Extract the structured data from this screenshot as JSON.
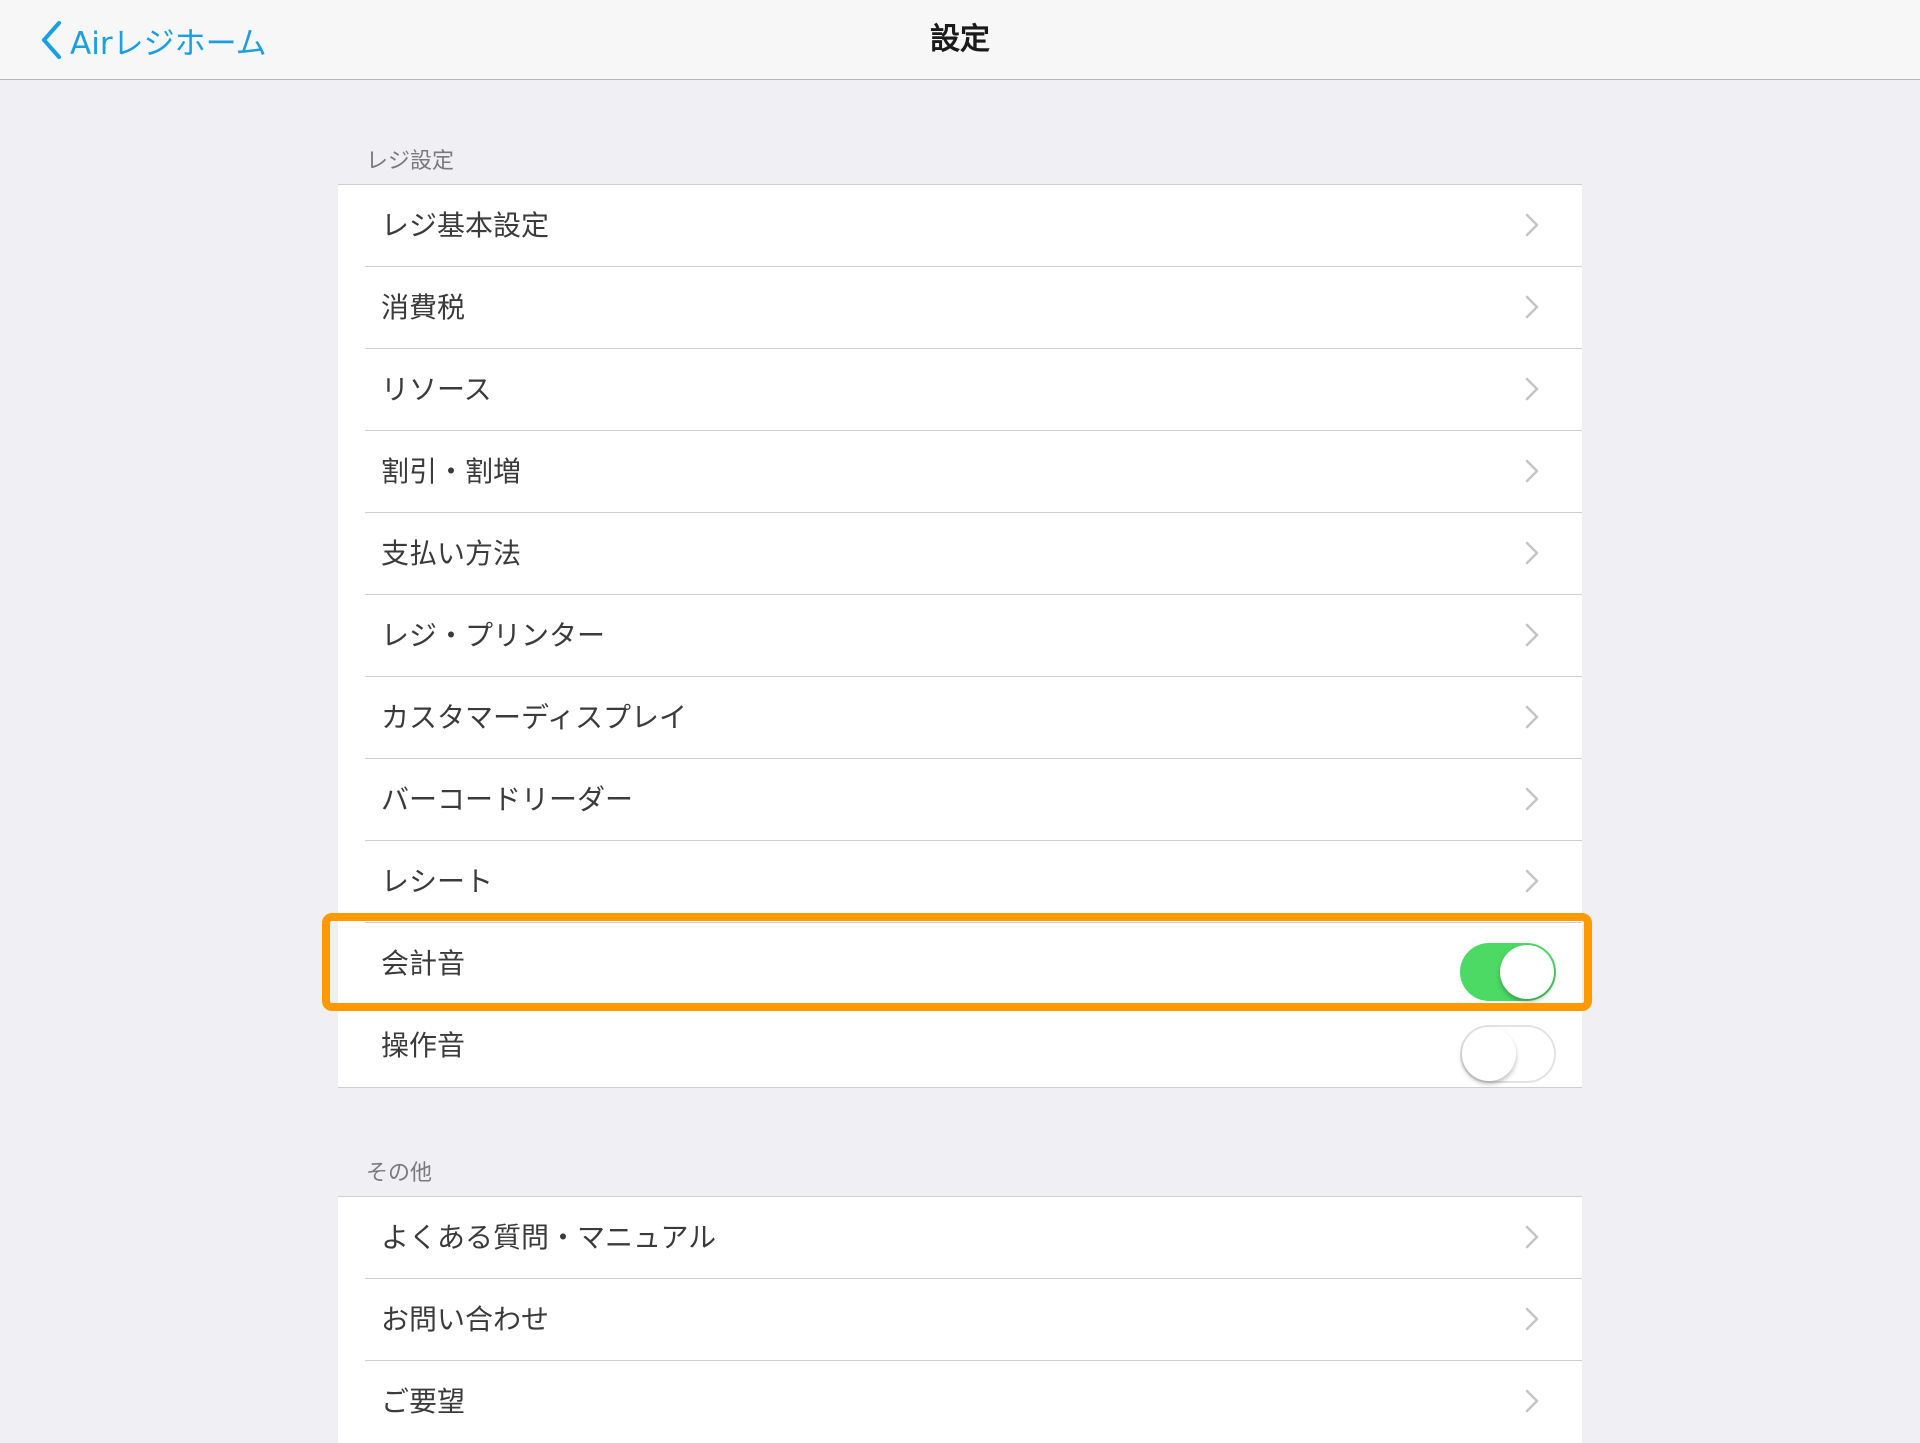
{
  "navbar": {
    "back_label": "Airレジホーム",
    "back_icon": "chevron-left-icon",
    "title": "設定"
  },
  "sections": [
    {
      "header": "レジ設定",
      "rows": [
        {
          "label": "レジ基本設定",
          "type": "link"
        },
        {
          "label": "消費税",
          "type": "link"
        },
        {
          "label": "リソース",
          "type": "link"
        },
        {
          "label": "割引・割増",
          "type": "link"
        },
        {
          "label": "支払い方法",
          "type": "link"
        },
        {
          "label": "レジ・プリンター",
          "type": "link"
        },
        {
          "label": "カスタマーディスプレイ",
          "type": "link"
        },
        {
          "label": "バーコードリーダー",
          "type": "link"
        },
        {
          "label": "レシート",
          "type": "link"
        },
        {
          "label": "会計音",
          "type": "toggle",
          "on": true
        },
        {
          "label": "操作音",
          "type": "toggle",
          "on": false
        }
      ]
    },
    {
      "header": "その他",
      "rows": [
        {
          "label": "よくある質問・マニュアル",
          "type": "link"
        },
        {
          "label": "お問い合わせ",
          "type": "link"
        },
        {
          "label": "ご要望",
          "type": "link"
        }
      ]
    }
  ],
  "colors": {
    "accent": "#1a9fe0",
    "toggle_on": "#4cd964",
    "highlight": "#ff9900",
    "background": "#efeff4"
  }
}
